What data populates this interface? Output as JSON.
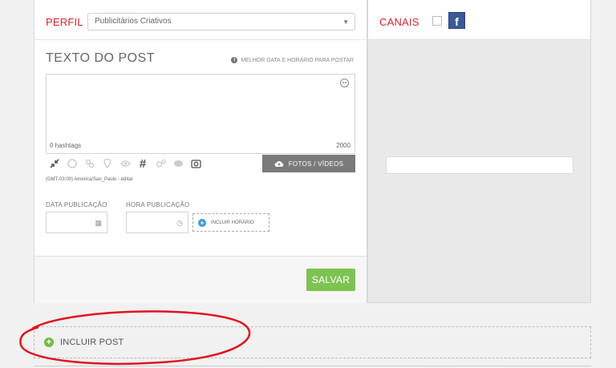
{
  "perfil": {
    "label": "PERFIL",
    "selected": "Publicitários Criativos"
  },
  "post": {
    "title": "TEXTO DO POST",
    "tip": "MELHOR DATA E HORÁRIO PARA POSTAR",
    "hashtags": "0 hashtags",
    "chars": "2000",
    "fotos_label": "FOTOS / VÍDEOS",
    "timezone": "(GMT-03:00) America/Sao_Paulo - editar"
  },
  "schedule": {
    "date_label": "DATA PUBLICAÇÃO",
    "time_label": "HORA PUBLICAÇÃO",
    "add_time": "INCLUIR HORÁRIO"
  },
  "actions": {
    "save": "SALVAR",
    "include_post": "INCLUIR POST"
  },
  "canais": {
    "label": "CANAIS",
    "facebook": "f"
  },
  "colors": {
    "accent_red": "#d9262e",
    "save_green": "#7dc352",
    "facebook_blue": "#3b5998",
    "annotation_red": "#e0141e"
  }
}
